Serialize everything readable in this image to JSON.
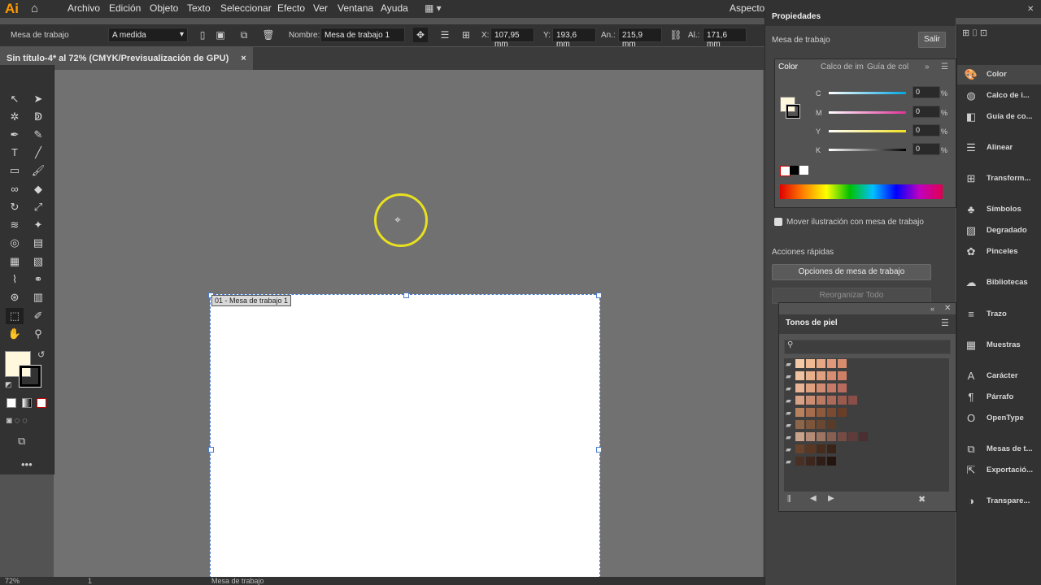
{
  "app": {
    "logo": "Ai"
  },
  "menu": [
    "Archivo",
    "Edición",
    "Objeto",
    "Texto",
    "Seleccionar",
    "Efecto",
    "Ver",
    "Ventana",
    "Ayuda"
  ],
  "workspace_label": "Aspecto",
  "control_bar": {
    "tool_label": "Mesa de trabajo",
    "preset": "A medida",
    "name_label": "Nombre:",
    "name_value": "Mesa de trabajo 1",
    "x_label": "X:",
    "x_value": "107,95 mm",
    "y_label": "Y:",
    "y_value": "193,6 mm",
    "w_label": "An.:",
    "w_value": "215,9 mm",
    "h_label": "Al.:",
    "h_value": "171,6 mm"
  },
  "document_tab": {
    "title": "Sin título-4* al 72% (CMYK/Previsualización de GPU)",
    "close": "×"
  },
  "artboard": {
    "label": "01 - Mesa de trabajo 1"
  },
  "status_bar": {
    "zoom": "72%",
    "page": "1",
    "tool": "Mesa de trabajo"
  },
  "properties": {
    "title": "Propiedades",
    "section": "Mesa de trabajo",
    "exit_button": "Salir",
    "move_checkbox": "Mover ilustración con mesa de trabajo",
    "quick_actions": "Acciones rápidas",
    "options_button": "Opciones de mesa de trabajo",
    "reorganize_button": "Reorganizar   Todo"
  },
  "color_panel": {
    "tabs": [
      "Color",
      "Calco de im",
      "Guía de col"
    ],
    "sliders": [
      {
        "label": "C",
        "value": "0",
        "unit": "%",
        "color": "#00a6e0"
      },
      {
        "label": "M",
        "value": "0",
        "unit": "%",
        "color": "#e0309a"
      },
      {
        "label": "Y",
        "value": "0",
        "unit": "%",
        "color": "#f0e020"
      },
      {
        "label": "K",
        "value": "0",
        "unit": "%",
        "color": "#000000"
      }
    ]
  },
  "skin_tones": {
    "title": "Tonos de piel"
  },
  "dock": [
    {
      "label": "Color",
      "icon": "palette-icon"
    },
    {
      "label": "Calco de i...",
      "icon": "trace-icon"
    },
    {
      "label": "Guía de co...",
      "icon": "color-guide-icon"
    },
    {
      "label": "Alinear",
      "icon": "align-icon"
    },
    {
      "label": "Transform...",
      "icon": "transform-icon"
    },
    {
      "label": "Símbolos",
      "icon": "symbols-icon"
    },
    {
      "label": "Degradado",
      "icon": "gradient-icon"
    },
    {
      "label": "Pinceles",
      "icon": "brushes-icon"
    },
    {
      "label": "Bibliotecas",
      "icon": "libraries-icon"
    },
    {
      "label": "Trazo",
      "icon": "stroke-icon"
    },
    {
      "label": "Muestras",
      "icon": "swatches-icon"
    },
    {
      "label": "Carácter",
      "icon": "character-icon"
    },
    {
      "label": "Párrafo",
      "icon": "paragraph-icon"
    },
    {
      "label": "OpenType",
      "icon": "opentype-icon"
    },
    {
      "label": "Mesas de t...",
      "icon": "artboards-icon"
    },
    {
      "label": "Exportació...",
      "icon": "export-icon"
    },
    {
      "label": "Transpare...",
      "icon": "transparency-icon"
    }
  ]
}
